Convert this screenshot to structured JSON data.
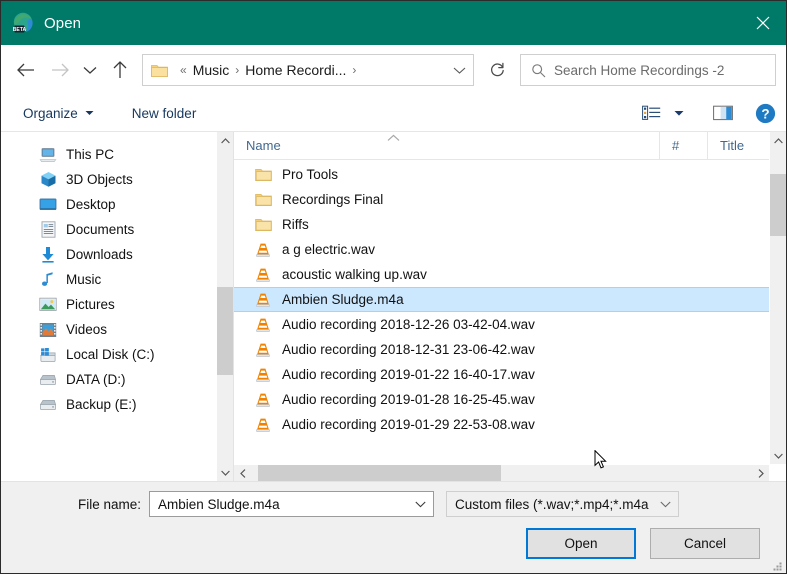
{
  "window": {
    "title": "Open",
    "app_icon": "edge-beta-icon",
    "close_label": "✕",
    "titlebar_color": "#007a68"
  },
  "nav": {
    "back": "back-arrow",
    "forward": "forward-arrow",
    "recent": "chevron-down",
    "up": "up-arrow",
    "refresh": "refresh-icon",
    "breadcrumbs": [
      "Music",
      "Home Recordi..."
    ],
    "overflow_chevron": "«",
    "separator": "›"
  },
  "search": {
    "placeholder": "Search Home Recordings -2",
    "icon": "search-icon"
  },
  "toolbar": {
    "organize_label": "Organize",
    "new_folder_label": "New folder",
    "view_icon": "view-layout-icon",
    "view_caret": "chevron-down-icon",
    "preview_pane_icon": "preview-pane-icon",
    "help_icon": "help-icon"
  },
  "sidebar": {
    "items": [
      {
        "label": "This PC",
        "icon": "computer-icon"
      },
      {
        "label": "3D Objects",
        "icon": "3d-objects-icon"
      },
      {
        "label": "Desktop",
        "icon": "desktop-icon"
      },
      {
        "label": "Documents",
        "icon": "documents-icon"
      },
      {
        "label": "Downloads",
        "icon": "downloads-icon"
      },
      {
        "label": "Music",
        "icon": "music-icon"
      },
      {
        "label": "Pictures",
        "icon": "pictures-icon"
      },
      {
        "label": "Videos",
        "icon": "videos-icon"
      },
      {
        "label": "Local Disk (C:)",
        "icon": "system-drive-icon"
      },
      {
        "label": "DATA (D:)",
        "icon": "drive-icon"
      },
      {
        "label": "Backup (E:)",
        "icon": "drive-icon"
      }
    ]
  },
  "filelist": {
    "columns": [
      {
        "label": "Name",
        "sorted": "ascending"
      },
      {
        "label": "#"
      },
      {
        "label": "Title"
      }
    ],
    "rows": [
      {
        "name": "Pro Tools",
        "icon": "folder-icon",
        "selected": false
      },
      {
        "name": "Recordings Final",
        "icon": "folder-icon",
        "selected": false
      },
      {
        "name": "Riffs",
        "icon": "folder-icon",
        "selected": false
      },
      {
        "name": "a g electric.wav",
        "icon": "vlc-icon",
        "selected": false
      },
      {
        "name": "acoustic walking up.wav",
        "icon": "vlc-icon",
        "selected": false
      },
      {
        "name": "Ambien Sludge.m4a",
        "icon": "vlc-icon",
        "selected": true
      },
      {
        "name": "Audio recording 2018-12-26 03-42-04.wav",
        "icon": "vlc-icon",
        "selected": false
      },
      {
        "name": "Audio recording 2018-12-31 23-06-42.wav",
        "icon": "vlc-icon",
        "selected": false
      },
      {
        "name": "Audio recording 2019-01-22 16-40-17.wav",
        "icon": "vlc-icon",
        "selected": false
      },
      {
        "name": "Audio recording 2019-01-28 16-25-45.wav",
        "icon": "vlc-icon",
        "selected": false
      },
      {
        "name": "Audio recording 2019-01-29 22-53-08.wav",
        "icon": "vlc-icon",
        "selected": false
      }
    ]
  },
  "footer": {
    "filename_label": "File name:",
    "filename_value": "Ambien Sludge.m4a",
    "filter_value": "Custom files (*.wav;*.mp4;*.m4a",
    "open_label": "Open",
    "cancel_label": "Cancel"
  },
  "colors": {
    "accent": "#0078d7",
    "selection": "#cce8ff",
    "titlebar": "#007a68",
    "command_text": "#16375e"
  }
}
